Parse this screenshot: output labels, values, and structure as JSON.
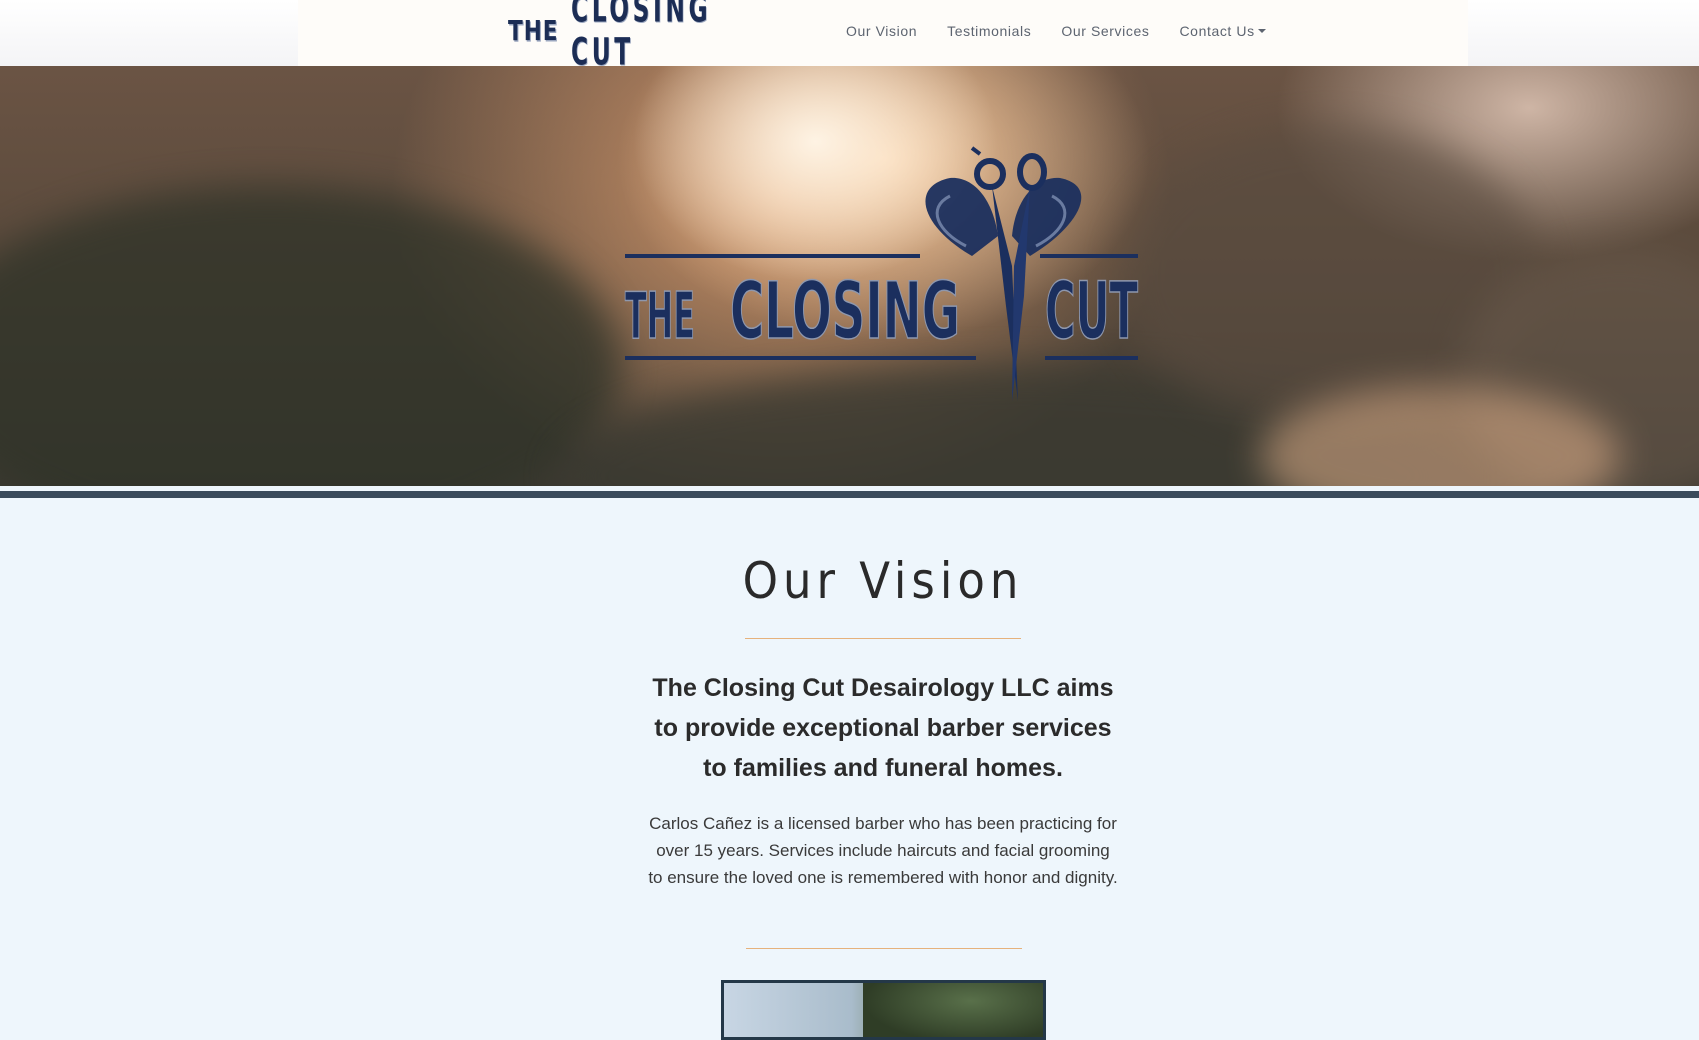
{
  "brand": {
    "nav_logo_the": "THE",
    "nav_logo_name": "CLOSING CUT",
    "hero_logo_the": "THE",
    "hero_logo_closing": "CLOSING",
    "hero_logo_cut": "CUT"
  },
  "nav": {
    "items": [
      {
        "label": "Our Vision"
      },
      {
        "label": "Testimonials"
      },
      {
        "label": "Our Services"
      },
      {
        "label": "Contact Us"
      }
    ]
  },
  "vision": {
    "title": "Our Vision",
    "lead": "The Closing Cut Desairology LLC aims to provide exceptional barber services to families and funeral homes.",
    "body": "Carlos Cañez is a licensed barber who has been practicing for over 15 years. Services include haircuts and facial grooming to ensure the loved one is remembered with honor and dignity."
  },
  "colors": {
    "brand_navy": "#1c2d55",
    "accent_rule": "#e6b27c",
    "section_bg": "#eef6fc",
    "hero_bar": "#3a4b5c"
  },
  "icons": {
    "hero_emblem": "winged-scissors-icon",
    "dropdown": "caret-down-icon"
  }
}
